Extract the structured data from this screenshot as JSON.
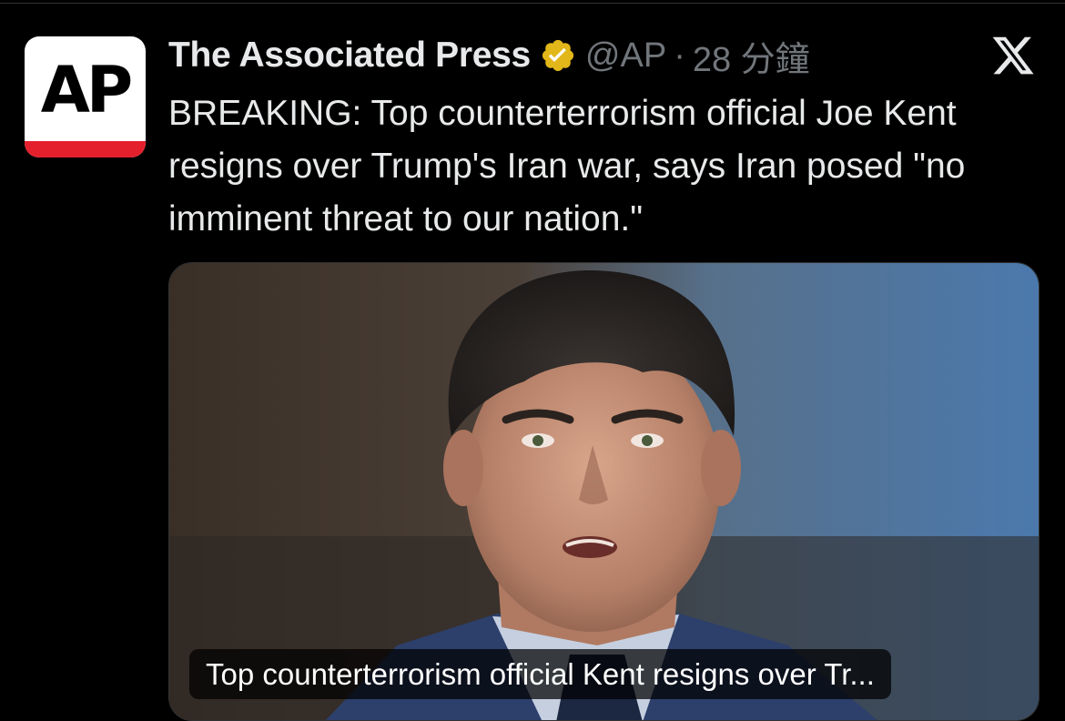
{
  "account": {
    "display_name": "The Associated Press",
    "avatar_text": "AP",
    "handle": "@AP",
    "separator": "·",
    "timestamp": "28 分鐘",
    "verified": true,
    "verified_color": "#e2b719"
  },
  "tweet": {
    "text": "BREAKING: Top counterterrorism official Joe Kent resigns over Trump's Iran war, says Iran posed \"no imminent threat to our nation.\""
  },
  "media": {
    "caption": "Top counterterrorism official Kent resigns over Tr..."
  },
  "icons": {
    "platform_logo": "x-logo-icon",
    "badge": "verified-badge-icon"
  },
  "colors": {
    "background": "#000000",
    "text_primary": "#e7e9ea",
    "text_secondary": "#71767b",
    "ap_red": "#e4202d"
  }
}
